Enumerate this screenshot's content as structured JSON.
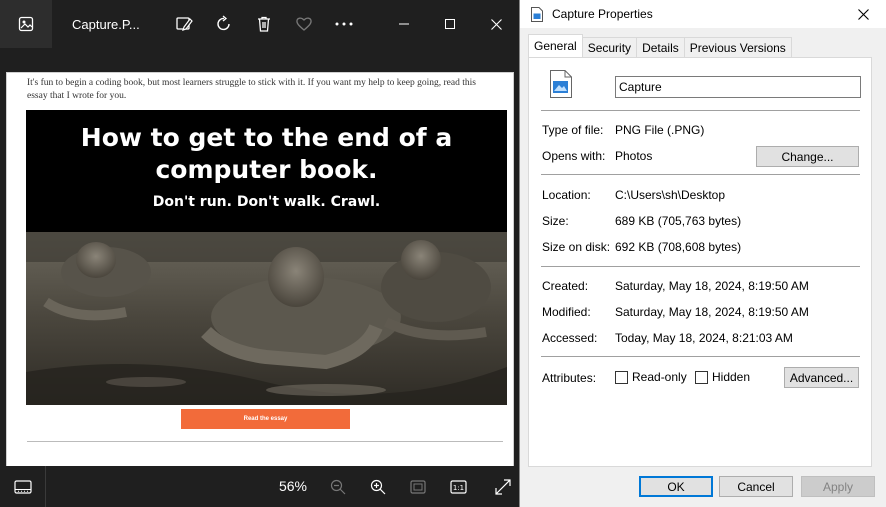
{
  "viewer": {
    "title": "Capture.P...",
    "page_text": "It's fun to begin a coding book, but most learners struggle to stick with it. If you want my help to keep going, read this essay that I wrote for you.",
    "banner": {
      "headline": "How to get to the end of a computer book.",
      "subline": "Don't run. Don't walk. Crawl."
    },
    "cta_label": "Read the essay",
    "zoom": "56%",
    "icons": {
      "app": "photos-app-icon",
      "edit": "edit-image-icon",
      "rotate": "rotate-icon",
      "delete": "trash-icon",
      "favorite": "heart-icon",
      "more": "more-icon",
      "minimize": "minimize-icon",
      "maximize": "maximize-icon",
      "close": "close-icon"
    }
  },
  "properties": {
    "title": "Capture Properties",
    "tabs": [
      "General",
      "Security",
      "Details",
      "Previous Versions"
    ],
    "file_name": "Capture",
    "type_label": "Type of file:",
    "type_value": "PNG File (.PNG)",
    "opens_label": "Opens with:",
    "opens_value": "Photos",
    "change_label": "Change...",
    "location_label": "Location:",
    "location_value": "C:\\Users\\sh\\Desktop",
    "size_label": "Size:",
    "size_value": "689 KB (705,763 bytes)",
    "size_disk_label": "Size on disk:",
    "size_disk_value": "692 KB (708,608 bytes)",
    "created_label": "Created:",
    "created_value": "Saturday, May 18, 2024, 8:19:50 AM",
    "modified_label": "Modified:",
    "modified_value": "Saturday, May 18, 2024, 8:19:50 AM",
    "accessed_label": "Accessed:",
    "accessed_value": "Today, May 18, 2024, 8:21:03 AM",
    "attributes_label": "Attributes:",
    "readonly_label": "Read-only",
    "hidden_label": "Hidden",
    "advanced_label": "Advanced...",
    "ok_label": "OK",
    "cancel_label": "Cancel",
    "apply_label": "Apply"
  },
  "colors": {
    "accent": "#0078d7",
    "cta": "#f26b3a"
  }
}
